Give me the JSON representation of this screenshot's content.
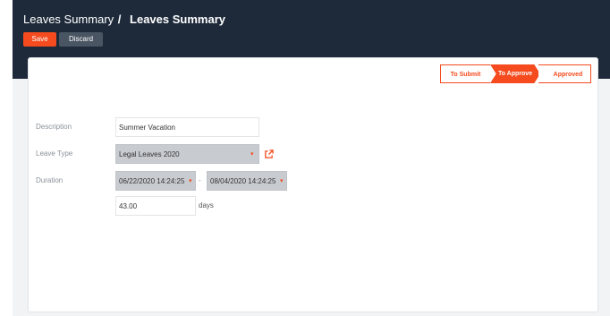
{
  "header": {
    "breadcrumb_parent": "Leaves Summary",
    "breadcrumb_separator": "/",
    "breadcrumb_current": "Leaves Summary"
  },
  "toolbar": {
    "save_label": "Save",
    "discard_label": "Discard"
  },
  "statusbar": {
    "stages": [
      "To Submit",
      "To Approve",
      "Approved"
    ],
    "active_stage": "To Approve"
  },
  "form": {
    "description_label": "Description",
    "description_value": "Summer Vacation",
    "leave_type_label": "Leave Type",
    "leave_type_value": "Legal Leaves 2020",
    "duration_label": "Duration",
    "date_from": "06/22/2020 14:24:25",
    "date_separator": "-",
    "date_to": "08/04/2020 14:24:25",
    "duration_value": "43.00",
    "duration_unit": "days"
  },
  "colors": {
    "accent": "#f54b1e",
    "topbar": "#1e2a3a",
    "discard": "#4a5563"
  },
  "icons": {
    "dropdown_caret": "caret-down-icon",
    "external_link": "external-link-icon"
  }
}
